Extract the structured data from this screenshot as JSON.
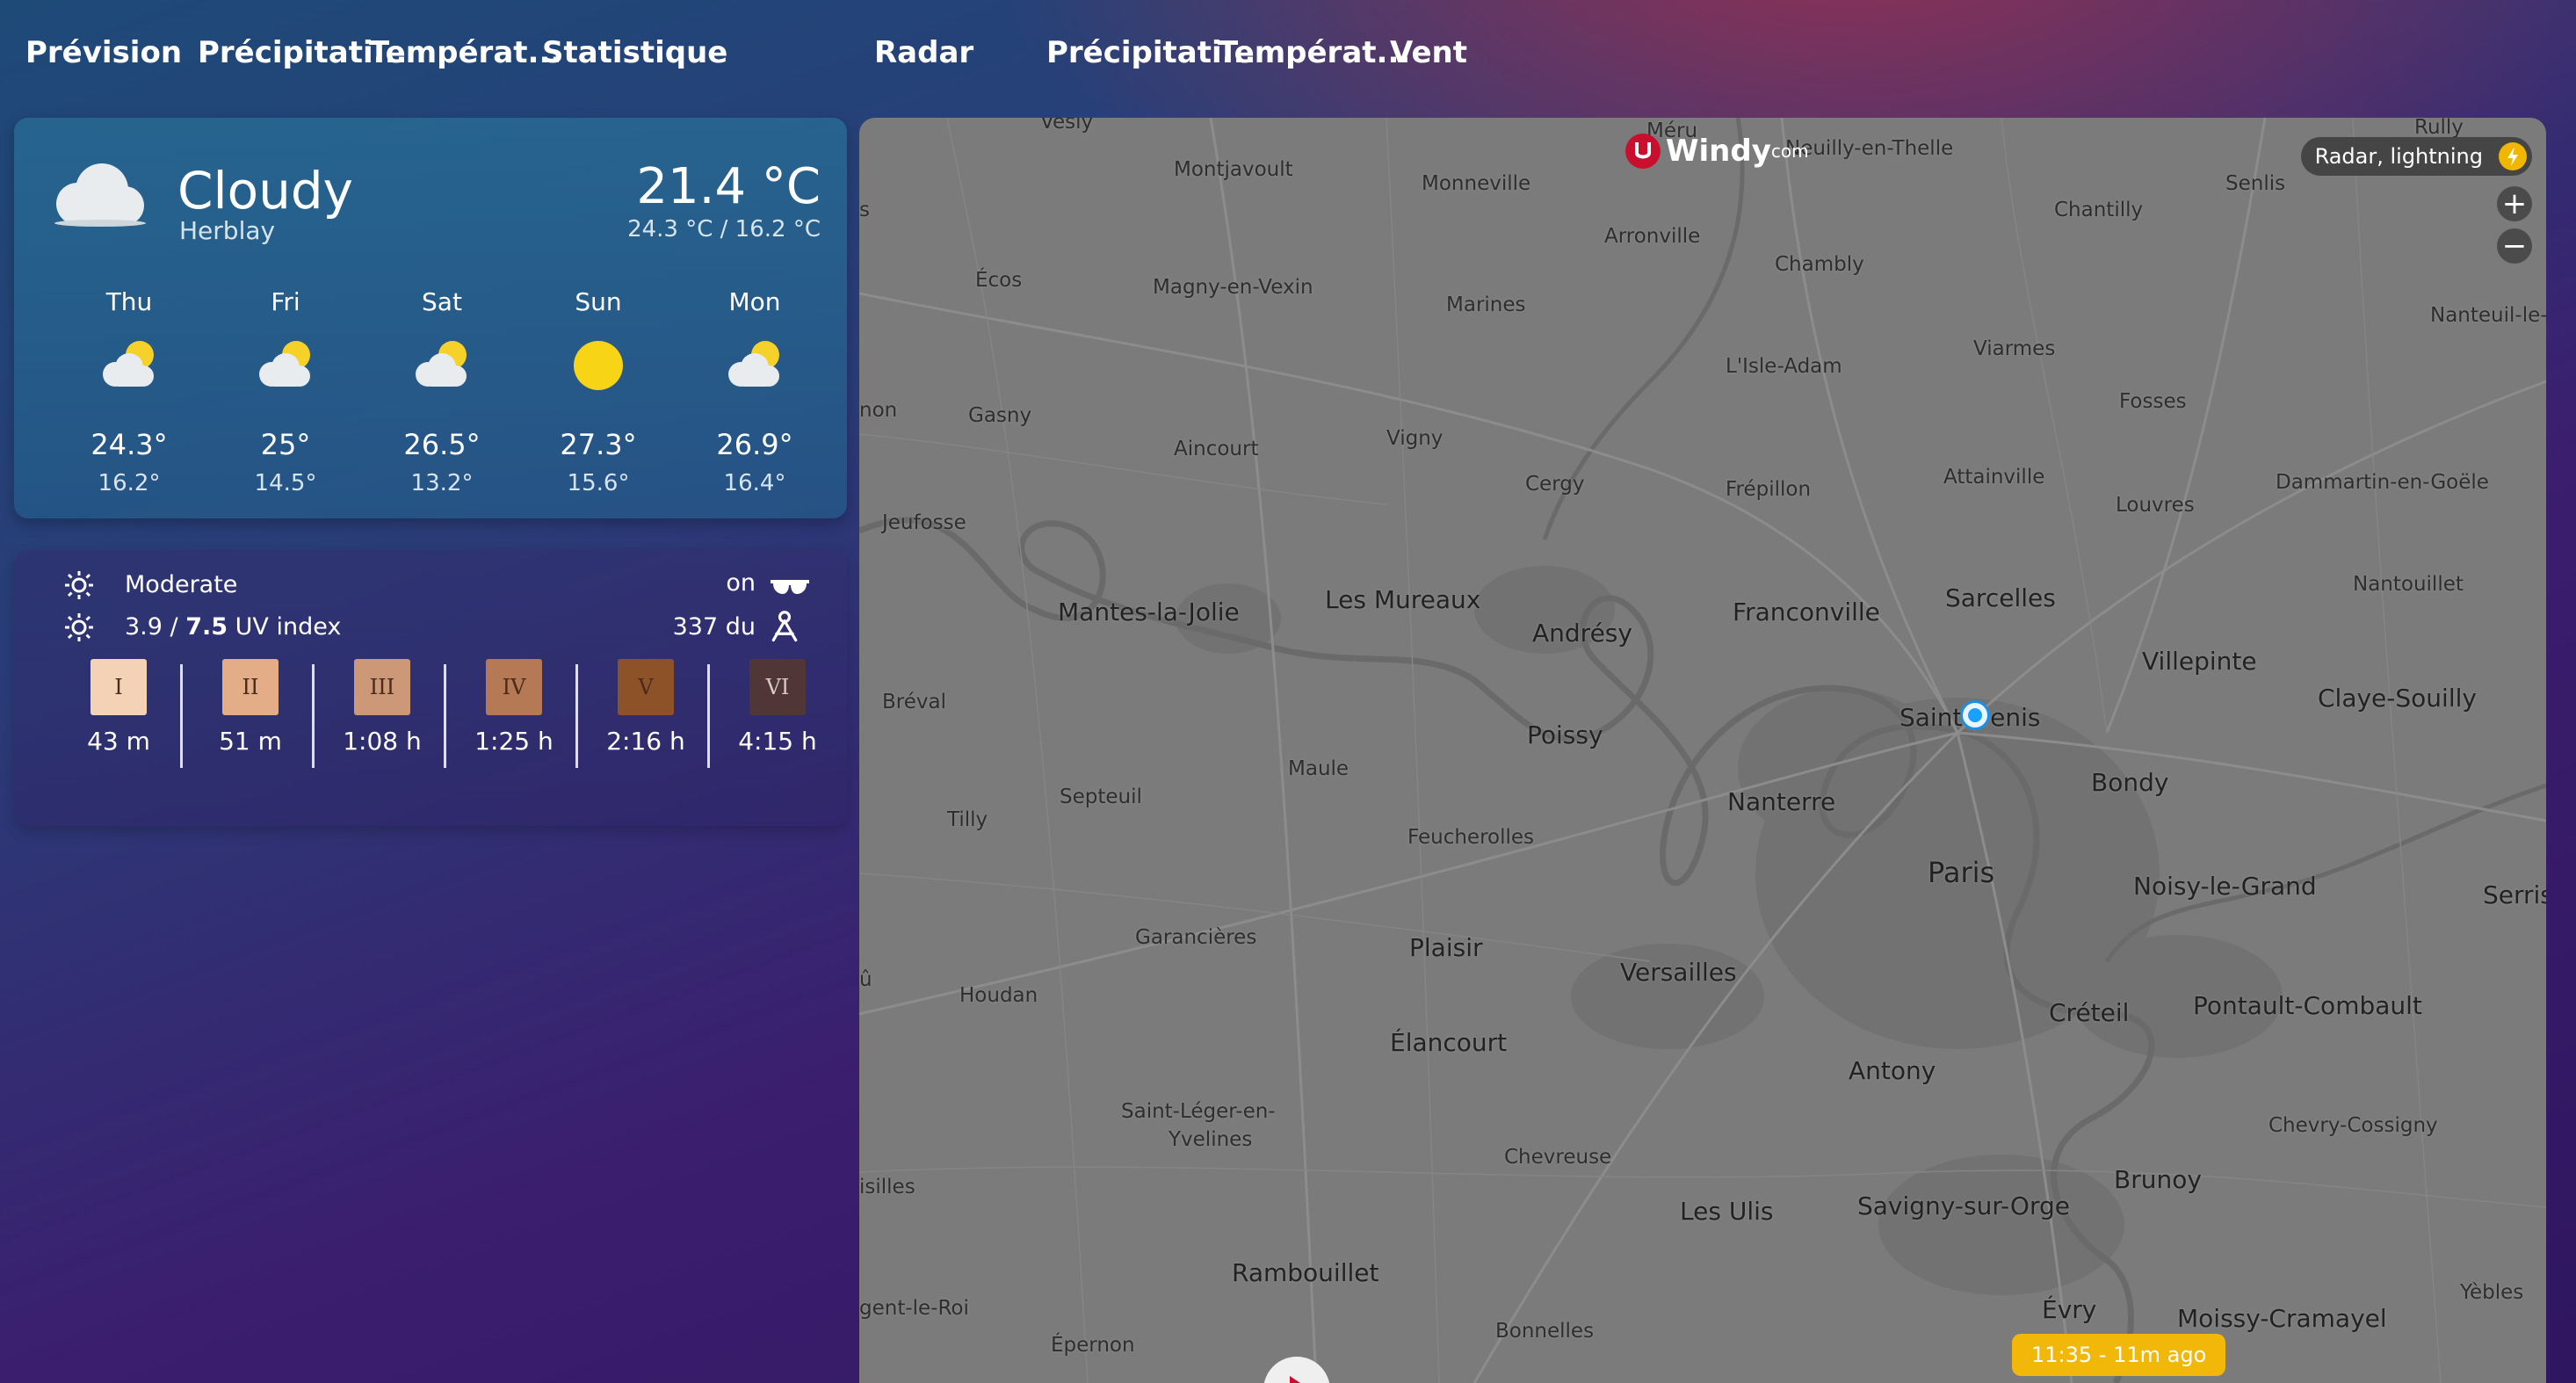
{
  "tabs": {
    "left": [
      "Prévision",
      "Précipitati...",
      "Températ...",
      "Statistique"
    ],
    "right": [
      "Radar",
      "Précipitati...",
      "Températ...",
      "Vent"
    ]
  },
  "current": {
    "condition": "Cloudy",
    "location": "Herblay",
    "temperature": "21.4 °C",
    "range": "24.3 °C / 16.2 °C",
    "icon": "cloud-icon"
  },
  "forecast": [
    {
      "day": "Thu",
      "high": "24.3°",
      "low": "16.2°",
      "icon": "partly-cloudy-icon"
    },
    {
      "day": "Fri",
      "high": "25°",
      "low": "14.5°",
      "icon": "partly-cloudy-icon"
    },
    {
      "day": "Sat",
      "high": "26.5°",
      "low": "13.2°",
      "icon": "partly-cloudy-icon"
    },
    {
      "day": "Sun",
      "high": "27.3°",
      "low": "15.6°",
      "icon": "sun-icon"
    },
    {
      "day": "Mon",
      "high": "26.9°",
      "low": "16.4°",
      "icon": "partly-cloudy-icon"
    }
  ],
  "uv": {
    "level": "Moderate",
    "index_current": "3.9",
    "index_separator": " / ",
    "index_max": "7.5",
    "index_label": " UV index",
    "sunglasses_label": "on",
    "direction_label": "337 du",
    "skin_types": [
      {
        "label": "I",
        "time": "43 m",
        "color": "#f3d2b6"
      },
      {
        "label": "II",
        "time": "51 m",
        "color": "#e2ad87"
      },
      {
        "label": "III",
        "time": "1:08 h",
        "color": "#cc9878"
      },
      {
        "label": "IV",
        "time": "1:25 h",
        "color": "#b57a55"
      },
      {
        "label": "V",
        "time": "2:16 h",
        "color": "#8e5228"
      },
      {
        "label": "VI",
        "time": "4:15 h",
        "color": "#503636"
      }
    ]
  },
  "map": {
    "logo": "Windy",
    "logo_suffix": "com",
    "layer_label": "Radar, lightning",
    "zoom_in": "+",
    "zoom_out": "−",
    "timestamp": "11:35 - 11m ago",
    "places": [
      "Vesly",
      "Montjavoult",
      "Monneville",
      "Méru",
      "Neuilly-en-Thelle",
      "Rully",
      "Chantilly",
      "Senlis",
      "Arronville",
      "Chambly",
      "Écos",
      "Magny-en-Vexin",
      "Marines",
      "Viarmes",
      "Nanteuil-le-",
      "L'Isle-Adam",
      "Fosses",
      "Gasny",
      "Aincourt",
      "Vigny",
      "Cergy",
      "Frépillon",
      "Attainville",
      "Louvres",
      "Dammartin-en-Goële",
      "Jeufosse",
      "Mantes-la-Jolie",
      "Les Mureaux",
      "Andrésy",
      "Franconville",
      "Sarcelles",
      "Nantouillet",
      "Villepinte",
      "Bréval",
      "Saint-Denis",
      "Claye-Souilly",
      "Poissy",
      "Maule",
      "Nanterre",
      "Bondy",
      "Septeuil",
      "Tilly",
      "Feucherolles",
      "Paris",
      "Noisy-le-Grand",
      "Serris",
      "Garancières",
      "Plaisir",
      "Versailles",
      "Houdan",
      "Élancourt",
      "Créteil",
      "Pontault-Combault",
      "Antony",
      "Saint-Léger-en-",
      "Yvelines",
      "Chevreuse",
      "Chevry-Cossigny",
      "Brunoy",
      "Les Ulis",
      "Savigny-sur-Orge",
      "isilles",
      "Rambouillet",
      "Yèbles",
      "gent-le-Roi",
      "Évry",
      "Moissy-Cramayel",
      "Bonnelles",
      "Épernon",
      "non",
      "û",
      "s"
    ]
  }
}
